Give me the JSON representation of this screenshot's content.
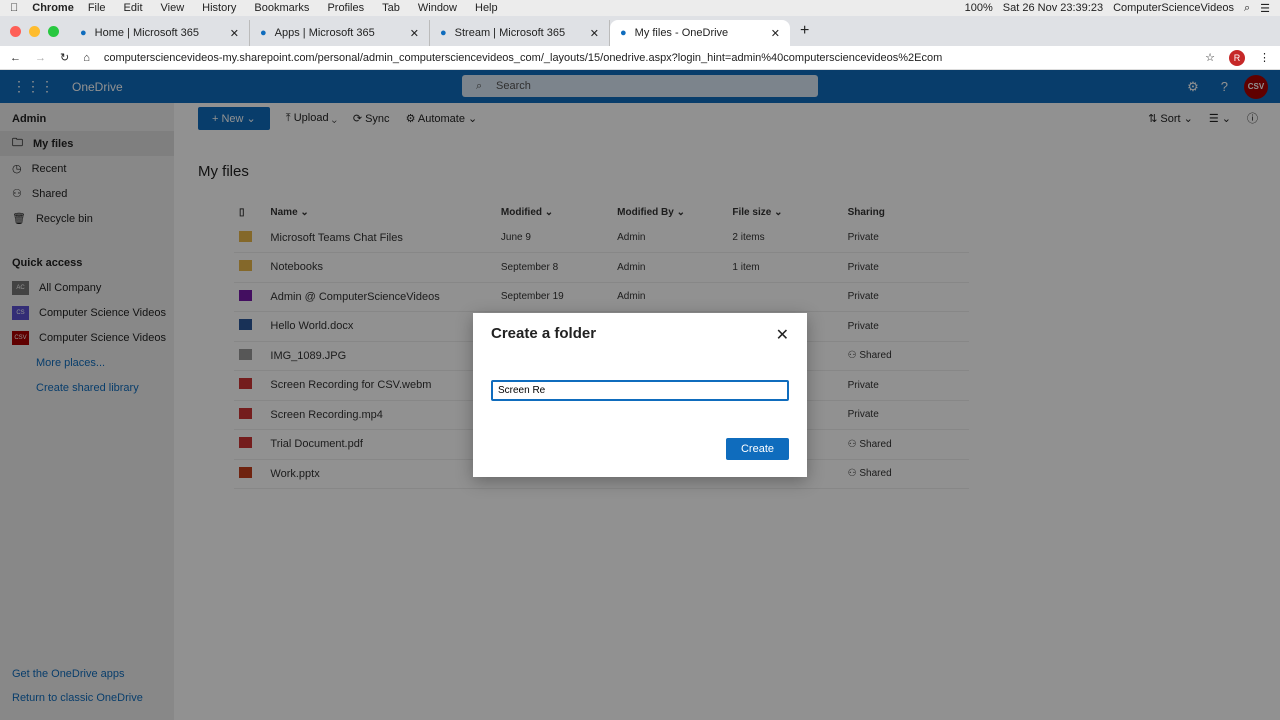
{
  "menubar": {
    "apple": "",
    "app": "Chrome",
    "items": [
      "File",
      "Edit",
      "View",
      "History",
      "Bookmarks",
      "Profiles",
      "Tab",
      "Window",
      "Help"
    ],
    "battery": "100%",
    "datetime": "Sat 26 Nov  23:39:23",
    "user": "ComputerScienceVideos"
  },
  "tabs": [
    {
      "title": "Home | Microsoft 365"
    },
    {
      "title": "Apps | Microsoft 365"
    },
    {
      "title": "Stream | Microsoft 365"
    },
    {
      "title": "My files - OneDrive",
      "active": true
    }
  ],
  "address": {
    "url": "computersciencevideos-my.sharepoint.com/personal/admin_computersciencevideos_com/_layouts/15/onedrive.aspx?login_hint=admin%40computersciencevideos%2Ecom",
    "profile": "R"
  },
  "header": {
    "app": "OneDrive",
    "search_placeholder": "Search",
    "avatar": "CSV"
  },
  "sidebar": {
    "user": "Admin",
    "items": [
      {
        "label": "My files",
        "icon": "folder-icon"
      },
      {
        "label": "Recent",
        "icon": "clock-icon"
      },
      {
        "label": "Shared",
        "icon": "people-icon"
      },
      {
        "label": "Recycle bin",
        "icon": "trash-icon"
      }
    ],
    "quick_access": "Quick access",
    "sites": [
      {
        "badge": "AC",
        "label": "All Company",
        "color": "#777"
      },
      {
        "badge": "CS",
        "label": "Computer Science Videos",
        "color": "#5a4fcf"
      },
      {
        "badge": "CSV",
        "label": "Computer Science Videos",
        "color": "#a00"
      }
    ],
    "more": "More places...",
    "create": "Create shared library",
    "get_apps": "Get the OneDrive apps",
    "classic": "Return to classic OneDrive"
  },
  "commands": {
    "new": "New",
    "upload": "Upload",
    "sync": "Sync",
    "automate": "Automate",
    "sort": "Sort"
  },
  "page_title": "My files",
  "columns": [
    "Name",
    "Modified",
    "Modified By",
    "File size",
    "Sharing"
  ],
  "files": [
    {
      "name": "Microsoft Teams Chat Files",
      "modified": "June 9",
      "by": "Admin",
      "size": "2 items",
      "sharing": "Private",
      "type": "folder"
    },
    {
      "name": "Notebooks",
      "modified": "September 8",
      "by": "Admin",
      "size": "1 item",
      "sharing": "Private",
      "type": "folder"
    },
    {
      "name": "Admin @ ComputerScienceVideos",
      "modified": "September 19",
      "by": "Admin",
      "size": "",
      "sharing": "Private",
      "type": "onenote"
    },
    {
      "name": "Hello World.docx",
      "modified": "",
      "by": "",
      "size": "",
      "sharing": "Private",
      "type": "word"
    },
    {
      "name": "IMG_1089.JPG",
      "modified": "",
      "by": "",
      "size": "",
      "sharing": "Shared",
      "type": "image"
    },
    {
      "name": "Screen Recording for CSV.webm",
      "modified": "",
      "by": "",
      "size": "",
      "sharing": "Private",
      "type": "video"
    },
    {
      "name": "Screen Recording.mp4",
      "modified": "",
      "by": "",
      "size": "",
      "sharing": "Private",
      "type": "video"
    },
    {
      "name": "Trial Document.pdf",
      "modified": "",
      "by": "",
      "size": "",
      "sharing": "Shared",
      "type": "pdf"
    },
    {
      "name": "Work.pptx",
      "modified": "",
      "by": "",
      "size": "",
      "sharing": "Shared",
      "type": "ppt"
    }
  ],
  "dialog": {
    "title": "Create a folder",
    "value": "Screen Re",
    "create": "Create"
  }
}
